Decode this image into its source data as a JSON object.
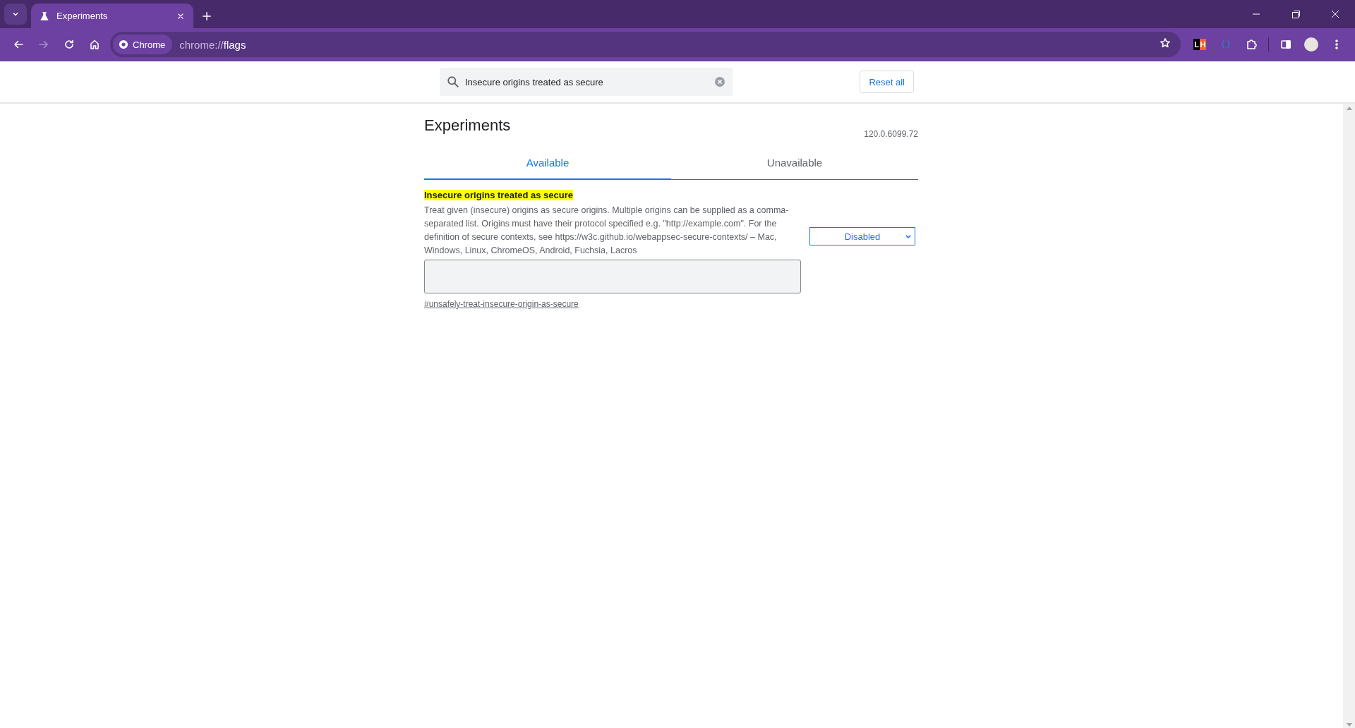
{
  "browser": {
    "tabs": [
      {
        "title": "Experiments",
        "selected": true
      }
    ],
    "address": {
      "chip": "Chrome",
      "scheme": "chrome://",
      "path": "flags"
    },
    "extension_badge": [
      "L",
      "H"
    ],
    "nav": [
      {
        "kind": "back",
        "disabled": false
      },
      {
        "kind": "forward",
        "disabled": true
      },
      {
        "kind": "reload",
        "disabled": false
      },
      {
        "kind": "home",
        "disabled": false
      }
    ]
  },
  "search": {
    "value": "Insecure origins treated as secure"
  },
  "reset_button": "Reset all",
  "title": "Experiments",
  "version": "120.0.6099.72",
  "page_tabs": [
    {
      "label": "Available",
      "selected": true
    },
    {
      "label": "Unavailable",
      "selected": false
    }
  ],
  "flags": [
    {
      "name": "Insecure origins treated as secure",
      "highlighted": true,
      "description": "Treat given (insecure) origins as secure origins. Multiple origins can be supplied as a comma-separated list. Origins must have their protocol specified e.g. \"http://example.com\". For the definition of secure contexts, see https://w3c.github.io/webappsec-secure-contexts/ – Mac, Windows, Linux, ChromeOS, Android, Fuchsia, Lacros",
      "link": "#unsafely-treat-insecure-origin-as-secure",
      "select": "Disabled"
    }
  ]
}
